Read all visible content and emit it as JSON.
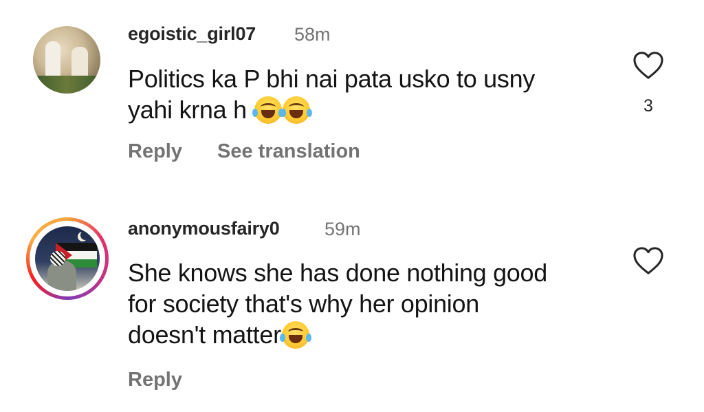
{
  "comments": [
    {
      "username": "egoistic_girl07",
      "time": "58m",
      "text_lines": [
        "Politics ka P bhi nai pata usko to usny",
        "yahi krna h"
      ],
      "emoji_after_line": 2,
      "emoji_count": 2,
      "actions": {
        "reply": "Reply",
        "translate": "See translation"
      },
      "likes": "3",
      "avatar": "photo-avatar",
      "story_ring": false
    },
    {
      "username": "anonymousfairy0",
      "time": "59m",
      "text_lines": [
        "She knows she has done nothing good",
        "for society that's why her opinion",
        "doesn't matter"
      ],
      "emoji_after_line": 3,
      "emoji_count": 1,
      "actions": {
        "reply": "Reply"
      },
      "likes": "",
      "avatar": "palestine-flag-avatar",
      "story_ring": true
    }
  ],
  "icons": {
    "like": "heart-outline-icon",
    "emoji": "face-with-tears-of-joy"
  },
  "colors": {
    "username": "#262626",
    "meta": "#737373",
    "text": "#141414",
    "story_ring_start": "#f9a43a",
    "story_ring_end": "#c13584"
  }
}
